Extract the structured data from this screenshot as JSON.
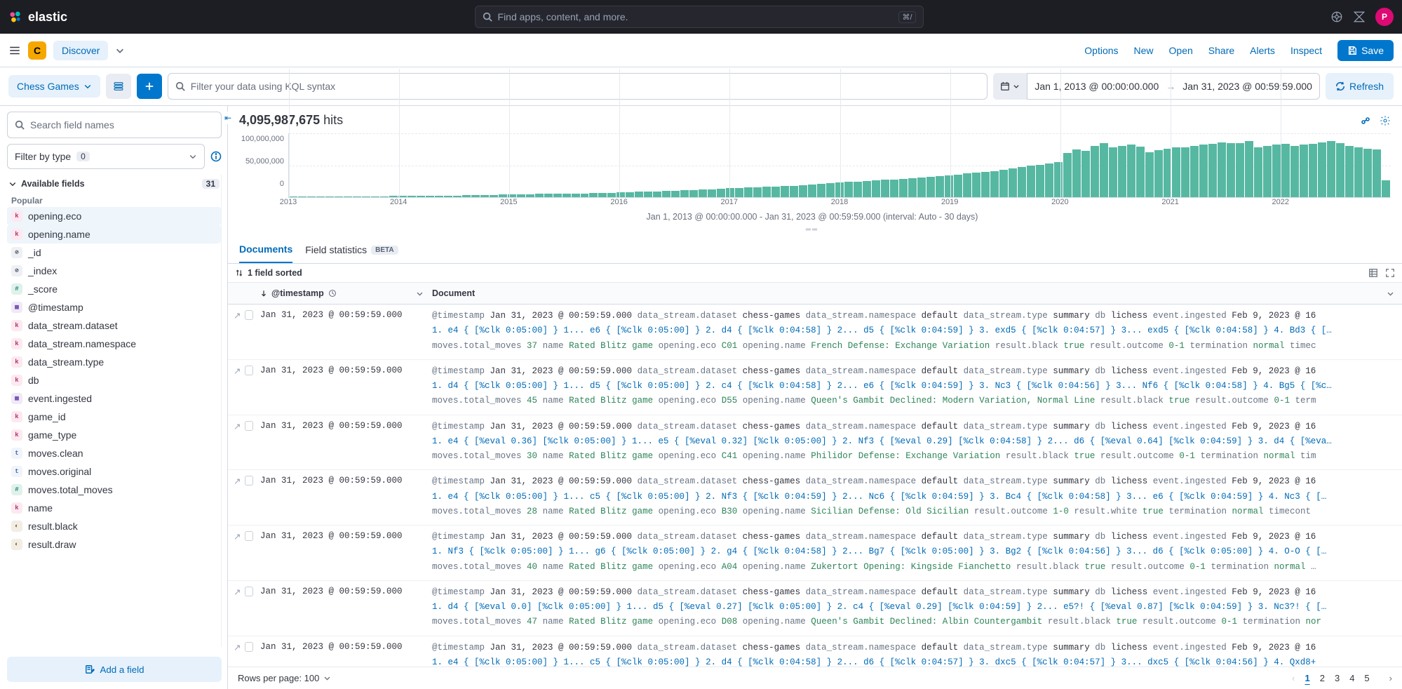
{
  "header": {
    "brand": "elastic",
    "searchPlaceholder": "Find apps, content, and more.",
    "kbd": "⌘/",
    "avatar": "P"
  },
  "toolbar": {
    "spaceInitial": "C",
    "discover": "Discover",
    "links": [
      "Options",
      "New",
      "Open",
      "Share",
      "Alerts",
      "Inspect"
    ],
    "save": "Save"
  },
  "query": {
    "dataView": "Chess Games",
    "kqlPlaceholder": "Filter your data using KQL syntax",
    "dateFrom": "Jan 1, 2013 @ 00:00:00.000",
    "dateTo": "Jan 31, 2023 @ 00:59:59.000",
    "refresh": "Refresh"
  },
  "sidebar": {
    "fieldSearchPlaceholder": "Search field names",
    "filterByType": "Filter by type",
    "filterCount": "0",
    "availableLabel": "Available fields",
    "availableCount": "31",
    "popularLabel": "Popular",
    "popular": [
      {
        "type": "k",
        "name": "opening.eco"
      },
      {
        "type": "k",
        "name": "opening.name"
      }
    ],
    "fields": [
      {
        "type": "o",
        "name": "_id"
      },
      {
        "type": "o",
        "name": "_index"
      },
      {
        "type": "n",
        "name": "_score"
      },
      {
        "type": "d",
        "name": "@timestamp"
      },
      {
        "type": "k",
        "name": "data_stream.dataset"
      },
      {
        "type": "k",
        "name": "data_stream.namespace"
      },
      {
        "type": "k",
        "name": "data_stream.type"
      },
      {
        "type": "k",
        "name": "db"
      },
      {
        "type": "d",
        "name": "event.ingested"
      },
      {
        "type": "k",
        "name": "game_id"
      },
      {
        "type": "k",
        "name": "game_type"
      },
      {
        "type": "t",
        "name": "moves.clean"
      },
      {
        "type": "t",
        "name": "moves.original"
      },
      {
        "type": "n",
        "name": "moves.total_moves"
      },
      {
        "type": "k",
        "name": "name"
      },
      {
        "type": "b",
        "name": "result.black"
      },
      {
        "type": "b",
        "name": "result.draw"
      }
    ],
    "addField": "Add a field"
  },
  "content": {
    "hitsCount": "4,095,987,675",
    "hitsWord": "hits",
    "chart_data": {
      "type": "bar",
      "yticks": [
        "100,000,000",
        "50,000,000",
        "0"
      ],
      "ylim": [
        0,
        100000000
      ],
      "xyears": [
        "2013",
        "2014",
        "2015",
        "2016",
        "2017",
        "2018",
        "2019",
        "2020",
        "2021",
        "2022"
      ],
      "caption": "Jan 1, 2013 @ 00:00:00.000 - Jan 31, 2023 @ 00:59:59.000 (interval: Auto - 30 days)",
      "values": [
        1,
        1,
        1,
        1,
        1,
        1,
        1,
        1,
        1,
        1,
        1,
        2,
        2,
        2,
        2,
        2,
        2,
        2,
        2,
        3,
        3,
        3,
        3,
        4,
        4,
        4,
        4,
        5,
        5,
        5,
        5,
        6,
        6,
        7,
        7,
        7,
        8,
        8,
        9,
        9,
        9,
        10,
        10,
        11,
        11,
        12,
        12,
        13,
        14,
        14,
        15,
        15,
        16,
        17,
        18,
        18,
        19,
        20,
        21,
        22,
        23,
        24,
        24,
        25,
        26,
        27,
        28,
        29,
        30,
        31,
        32,
        33,
        34,
        35,
        37,
        38,
        40,
        41,
        43,
        45,
        47,
        49,
        51,
        53,
        55,
        69,
        75,
        72,
        80,
        85,
        78,
        80,
        82,
        79,
        70,
        74,
        76,
        78,
        78,
        80,
        82,
        84,
        86,
        85,
        85,
        88,
        78,
        80,
        82,
        84,
        80,
        82,
        84,
        86,
        88,
        85,
        80,
        78,
        76,
        75,
        26
      ]
    },
    "tabs": {
      "documents": "Documents",
      "fieldStats": "Field statistics",
      "beta": "BETA"
    },
    "sorted": "1 field sorted",
    "columns": {
      "ts": "@timestamp",
      "doc": "Document"
    },
    "rows": [
      {
        "ts": "Jan 31, 2023 @ 00:59:59.000",
        "kv": [
          [
            "@timestamp",
            "Jan 31, 2023 @ 00:59:59.000"
          ],
          [
            "data_stream.dataset",
            "chess-games"
          ],
          [
            "data_stream.namespace",
            "default"
          ],
          [
            "data_stream.type",
            "summary"
          ],
          [
            "db",
            "lichess"
          ],
          [
            "event.ingested",
            "Feb 9, 2023 @ 16"
          ]
        ],
        "moves": "1. e4 { [%clk 0:05:00] } 1... e6 { [%clk 0:05:00] } 2. d4 { [%clk 0:04:58] } 2... d5 { [%clk 0:04:59] } 3. exd5 { [%clk 0:04:57] } 3... exd5 { [%clk 0:04:58] } 4. Bd3 { […",
        "kv2": [
          [
            "moves.total_moves",
            "37"
          ],
          [
            "name",
            "Rated Blitz game"
          ],
          [
            "opening.eco",
            "C01"
          ],
          [
            "opening.name",
            "French Defense: Exchange Variation"
          ],
          [
            "result.black",
            "true"
          ],
          [
            "result.outcome",
            "0-1"
          ],
          [
            "termination",
            "normal"
          ],
          [
            "timec",
            ""
          ]
        ]
      },
      {
        "ts": "Jan 31, 2023 @ 00:59:59.000",
        "kv": [
          [
            "@timestamp",
            "Jan 31, 2023 @ 00:59:59.000"
          ],
          [
            "data_stream.dataset",
            "chess-games"
          ],
          [
            "data_stream.namespace",
            "default"
          ],
          [
            "data_stream.type",
            "summary"
          ],
          [
            "db",
            "lichess"
          ],
          [
            "event.ingested",
            "Feb 9, 2023 @ 16"
          ]
        ],
        "moves": "1. d4 { [%clk 0:05:00] } 1... d5 { [%clk 0:05:00] } 2. c4 { [%clk 0:04:58] } 2... e6 { [%clk 0:04:59] } 3. Nc3 { [%clk 0:04:56] } 3... Nf6 { [%clk 0:04:58] } 4. Bg5 { [%c…",
        "kv2": [
          [
            "moves.total_moves",
            "45"
          ],
          [
            "name",
            "Rated Blitz game"
          ],
          [
            "opening.eco",
            "D55"
          ],
          [
            "opening.name",
            "Queen's Gambit Declined: Modern Variation, Normal Line"
          ],
          [
            "result.black",
            "true"
          ],
          [
            "result.outcome",
            "0-1"
          ],
          [
            "term",
            ""
          ]
        ]
      },
      {
        "ts": "Jan 31, 2023 @ 00:59:59.000",
        "kv": [
          [
            "@timestamp",
            "Jan 31, 2023 @ 00:59:59.000"
          ],
          [
            "data_stream.dataset",
            "chess-games"
          ],
          [
            "data_stream.namespace",
            "default"
          ],
          [
            "data_stream.type",
            "summary"
          ],
          [
            "db",
            "lichess"
          ],
          [
            "event.ingested",
            "Feb 9, 2023 @ 16"
          ]
        ],
        "moves": "1. e4 { [%eval 0.36] [%clk 0:05:00] } 1... e5 { [%eval 0.32] [%clk 0:05:00] } 2. Nf3 { [%eval 0.29] [%clk 0:04:58] } 2... d6 { [%eval 0.64] [%clk 0:04:59] } 3. d4 { [%eva…",
        "kv2": [
          [
            "moves.total_moves",
            "30"
          ],
          [
            "name",
            "Rated Blitz game"
          ],
          [
            "opening.eco",
            "C41"
          ],
          [
            "opening.name",
            "Philidor Defense: Exchange Variation"
          ],
          [
            "result.black",
            "true"
          ],
          [
            "result.outcome",
            "0-1"
          ],
          [
            "termination",
            "normal"
          ],
          [
            "tim",
            ""
          ]
        ]
      },
      {
        "ts": "Jan 31, 2023 @ 00:59:59.000",
        "kv": [
          [
            "@timestamp",
            "Jan 31, 2023 @ 00:59:59.000"
          ],
          [
            "data_stream.dataset",
            "chess-games"
          ],
          [
            "data_stream.namespace",
            "default"
          ],
          [
            "data_stream.type",
            "summary"
          ],
          [
            "db",
            "lichess"
          ],
          [
            "event.ingested",
            "Feb 9, 2023 @ 16"
          ]
        ],
        "moves": "1. e4 { [%clk 0:05:00] } 1... c5 { [%clk 0:05:00] } 2. Nf3 { [%clk 0:04:59] } 2... Nc6 { [%clk 0:04:59] } 3. Bc4 { [%clk 0:04:58] } 3... e6 { [%clk 0:04:59] } 4. Nc3 { […",
        "kv2": [
          [
            "moves.total_moves",
            "28"
          ],
          [
            "name",
            "Rated Blitz game"
          ],
          [
            "opening.eco",
            "B30"
          ],
          [
            "opening.name",
            "Sicilian Defense: Old Sicilian"
          ],
          [
            "result.outcome",
            "1-0"
          ],
          [
            "result.white",
            "true"
          ],
          [
            "termination",
            "normal"
          ],
          [
            "timecont",
            ""
          ]
        ]
      },
      {
        "ts": "Jan 31, 2023 @ 00:59:59.000",
        "kv": [
          [
            "@timestamp",
            "Jan 31, 2023 @ 00:59:59.000"
          ],
          [
            "data_stream.dataset",
            "chess-games"
          ],
          [
            "data_stream.namespace",
            "default"
          ],
          [
            "data_stream.type",
            "summary"
          ],
          [
            "db",
            "lichess"
          ],
          [
            "event.ingested",
            "Feb 9, 2023 @ 16"
          ]
        ],
        "moves": "1. Nf3 { [%clk 0:05:00] } 1... g6 { [%clk 0:05:00] } 2. g4 { [%clk 0:04:58] } 2... Bg7 { [%clk 0:05:00] } 3. Bg2 { [%clk 0:04:56] } 3... d6 { [%clk 0:05:00] } 4. O-O { […",
        "kv2": [
          [
            "moves.total_moves",
            "40"
          ],
          [
            "name",
            "Rated Blitz game"
          ],
          [
            "opening.eco",
            "A04"
          ],
          [
            "opening.name",
            "Zukertort Opening: Kingside Fianchetto"
          ],
          [
            "result.black",
            "true"
          ],
          [
            "result.outcome",
            "0-1"
          ],
          [
            "termination",
            "normal"
          ],
          [
            "…",
            ""
          ]
        ]
      },
      {
        "ts": "Jan 31, 2023 @ 00:59:59.000",
        "kv": [
          [
            "@timestamp",
            "Jan 31, 2023 @ 00:59:59.000"
          ],
          [
            "data_stream.dataset",
            "chess-games"
          ],
          [
            "data_stream.namespace",
            "default"
          ],
          [
            "data_stream.type",
            "summary"
          ],
          [
            "db",
            "lichess"
          ],
          [
            "event.ingested",
            "Feb 9, 2023 @ 16"
          ]
        ],
        "moves": "1. d4 { [%eval 0.0] [%clk 0:05:00] } 1... d5 { [%eval 0.27] [%clk 0:05:00] } 2. c4 { [%eval 0.29] [%clk 0:04:59] } 2... e5?! { [%eval 0.87] [%clk 0:04:59] } 3. Nc3?! { […",
        "kv2": [
          [
            "moves.total_moves",
            "47"
          ],
          [
            "name",
            "Rated Blitz game"
          ],
          [
            "opening.eco",
            "D08"
          ],
          [
            "opening.name",
            "Queen's Gambit Declined: Albin Countergambit"
          ],
          [
            "result.black",
            "true"
          ],
          [
            "result.outcome",
            "0-1"
          ],
          [
            "termination",
            "nor",
            ""
          ]
        ]
      },
      {
        "ts": "Jan 31, 2023 @ 00:59:59.000",
        "kv": [
          [
            "@timestamp",
            "Jan 31, 2023 @ 00:59:59.000"
          ],
          [
            "data_stream.dataset",
            "chess-games"
          ],
          [
            "data_stream.namespace",
            "default"
          ],
          [
            "data_stream.type",
            "summary"
          ],
          [
            "db",
            "lichess"
          ],
          [
            "event.ingested",
            "Feb 9, 2023 @ 16"
          ]
        ],
        "moves": "1. e4 { [%clk 0:05:00] } 1... c5 { [%clk 0:05:00] } 2. d4 { [%clk 0:04:58] } 2... d6 { [%clk 0:04:57] } 3. dxc5 { [%clk 0:04:57] } 3... dxc5 { [%clk 0:04:56] } 4. Qxd8+",
        "kv2": []
      }
    ],
    "rowsPerPage": "Rows per page: 100",
    "pages": [
      "1",
      "2",
      "3",
      "4",
      "5"
    ]
  }
}
